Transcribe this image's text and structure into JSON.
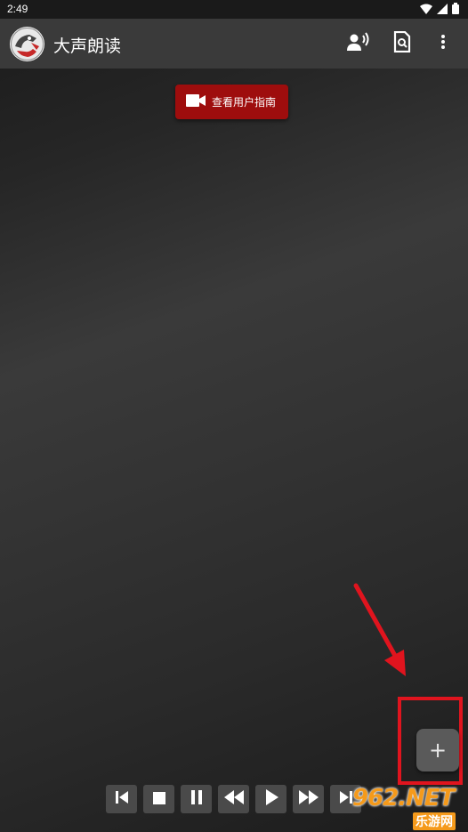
{
  "status_bar": {
    "time": "2:49",
    "icons": [
      "wifi-icon",
      "signal-icon",
      "battery-icon"
    ]
  },
  "app_bar": {
    "title": "大声朗读",
    "actions": [
      "voice-icon",
      "document-search-icon",
      "more-vert-icon"
    ]
  },
  "guide_button": {
    "label": "查看用户指南",
    "icon": "video-camera-icon"
  },
  "fab": {
    "label": "+"
  },
  "media_controls": [
    "skip-previous-icon",
    "stop-icon",
    "pause-icon",
    "rewind-icon",
    "play-icon",
    "fast-forward-icon",
    "skip-next-icon"
  ],
  "watermark": {
    "text": "962.NET",
    "subtext": "乐游网"
  },
  "colors": {
    "accent_red": "#9e0d0d",
    "annotation_red": "#e0141e",
    "appbar": "#3a3a3a",
    "watermark_orange": "#f59a1b"
  }
}
